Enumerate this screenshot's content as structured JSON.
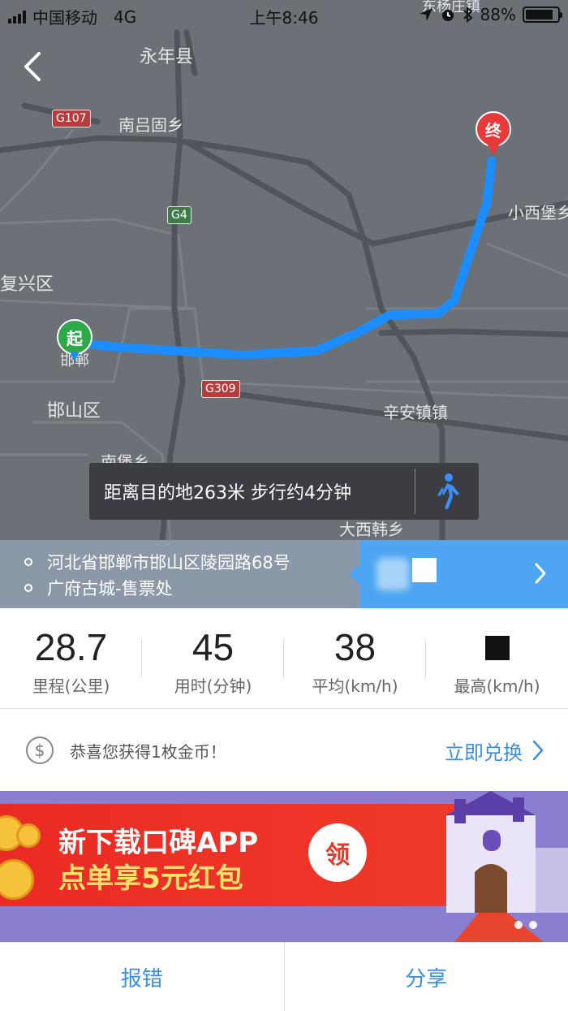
{
  "status_bar": {
    "carrier": "中国移动",
    "network": "4G",
    "time": "上午8:46",
    "battery_percent": "88%",
    "battery_level": 0.88
  },
  "map": {
    "places": [
      {
        "text": "永年县"
      },
      {
        "text": "南吕固乡"
      },
      {
        "text": "小西堡乡"
      },
      {
        "text": "复兴区"
      },
      {
        "text": "邯郸"
      },
      {
        "text": "邯山区"
      },
      {
        "text": "辛安镇镇"
      },
      {
        "text": "南堡乡"
      },
      {
        "text": "大西韩乡"
      },
      {
        "text": "东杨庄镇"
      }
    ],
    "shields": [
      {
        "text": "G107"
      },
      {
        "text": "G4"
      },
      {
        "text": "G309"
      }
    ],
    "start_label": "起",
    "end_label": "终",
    "route_color": "#1c8dff",
    "distance_text": "距离目的地263米 步行约4分钟"
  },
  "route": {
    "from": "河北省邯郸市邯山区陵园路68号",
    "to": "广府古城-售票处"
  },
  "stats": [
    {
      "value": "28.7",
      "label": "里程(公里)"
    },
    {
      "value": "45",
      "label": "用时(分钟)"
    },
    {
      "value": "38",
      "label": "平均(km/h)"
    },
    {
      "value": "",
      "label": "最高(km/h)"
    }
  ],
  "coin": {
    "icon": "dollar-coin-icon",
    "message": "恭喜您获得1枚金币！",
    "action": "立即兑换"
  },
  "banner": {
    "line1": "新下载口碑APP",
    "line2": "点单享5元红包",
    "button": "领"
  },
  "bottom": {
    "report": "报错",
    "share": "分享"
  },
  "colors": {
    "accent": "#3a8fdf",
    "start_pin": "#2ea84a",
    "end_pin": "#e83a3a"
  }
}
